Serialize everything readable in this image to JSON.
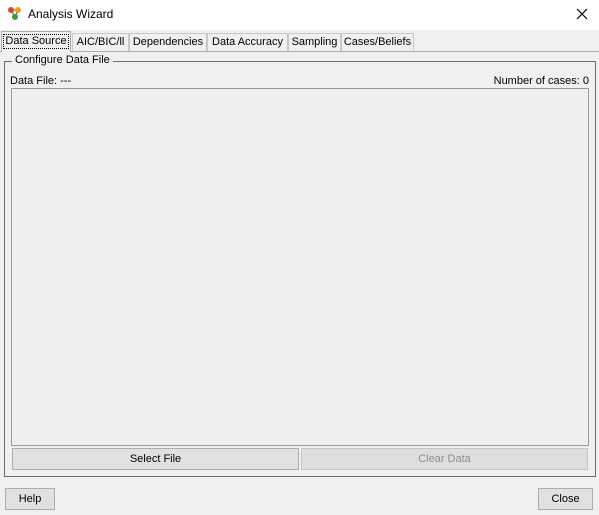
{
  "window": {
    "title": "Analysis Wizard",
    "app_icon": "network-graph-icon",
    "close_icon": "close-icon"
  },
  "tabs": [
    {
      "label": "Data Source",
      "active": true
    },
    {
      "label": "AIC/BIC/ll",
      "active": false
    },
    {
      "label": "Dependencies",
      "active": false
    },
    {
      "label": "Data Accuracy",
      "active": false
    },
    {
      "label": "Sampling",
      "active": false
    },
    {
      "label": "Cases/Beliefs",
      "active": false
    }
  ],
  "config": {
    "group_title": "Configure Data File",
    "data_file_label": "Data File: ---",
    "cases_label": "Number of cases: 0",
    "select_file_label": "Select File",
    "clear_data_label": "Clear Data"
  },
  "footer": {
    "help_label": "Help",
    "close_label": "Close"
  }
}
